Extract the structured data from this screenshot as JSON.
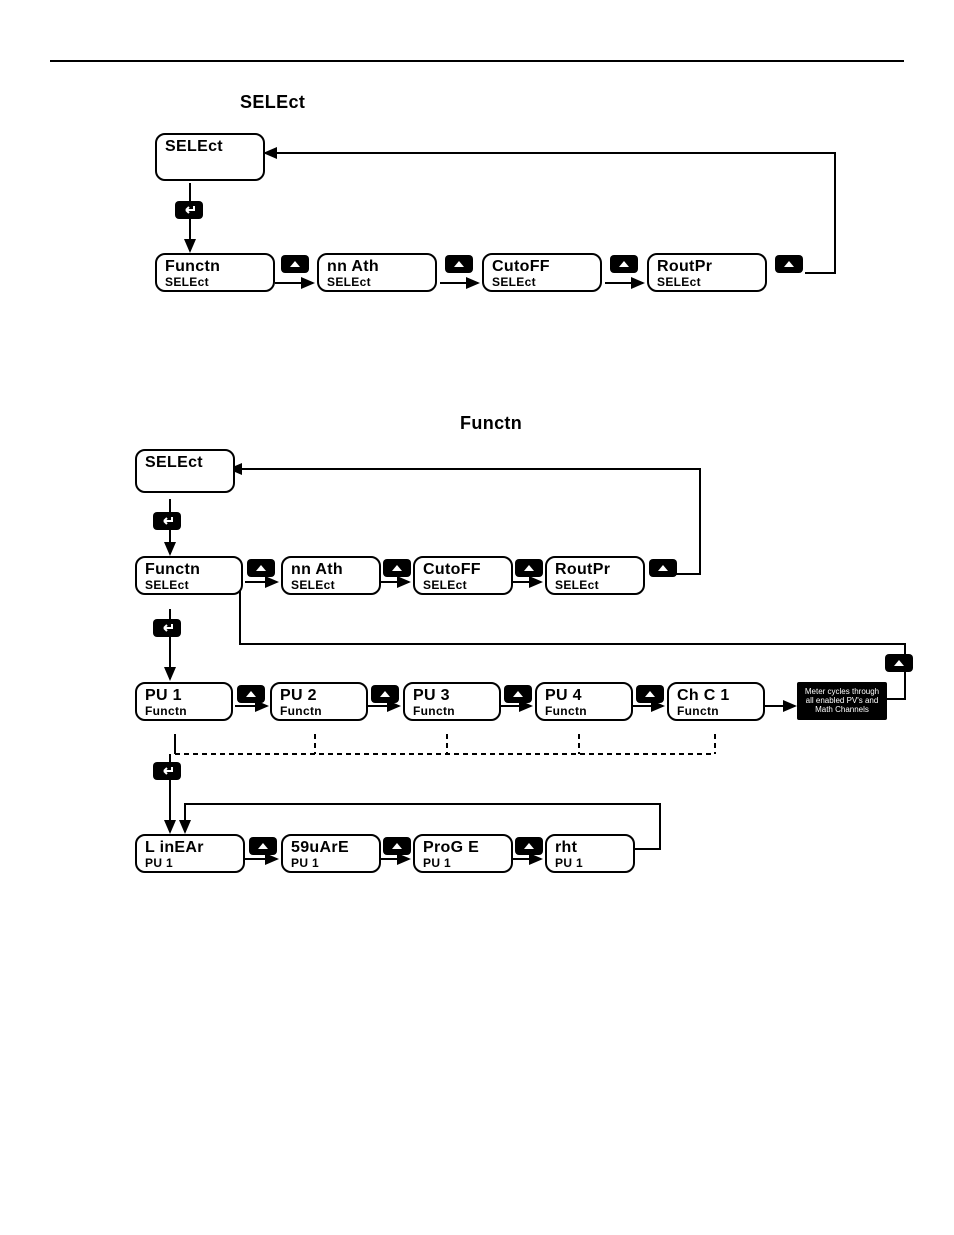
{
  "header_word": "SELEct",
  "section2_word": "Functn",
  "diagram1": {
    "top": {
      "line1": "SELEct"
    },
    "row": [
      {
        "line1": "Functn",
        "line2": "SELEct"
      },
      {
        "line1": "nn Ath",
        "line2": "SELEct"
      },
      {
        "line1": "CutoFF",
        "line2": "SELEct"
      },
      {
        "line1": "RoutPr",
        "line2": "SELEct"
      }
    ]
  },
  "diagram2": {
    "top": {
      "line1": "SELEct"
    },
    "row1": [
      {
        "line1": "Functn",
        "line2": "SELEct"
      },
      {
        "line1": "nn Ath",
        "line2": "SELEct"
      },
      {
        "line1": "CutoFF",
        "line2": "SELEct"
      },
      {
        "line1": "RoutPr",
        "line2": "SELEct"
      }
    ],
    "row2": [
      {
        "line1": "PU  1",
        "line2": "Functn"
      },
      {
        "line1": "PU  2",
        "line2": "Functn"
      },
      {
        "line1": "PU  3",
        "line2": "Functn"
      },
      {
        "line1": "PU  4",
        "line2": "Functn"
      },
      {
        "line1": "Ch C 1",
        "line2": "Functn"
      }
    ],
    "note": "Meter cycles through all enabled PV's and Math Channels",
    "row3": [
      {
        "line1": "L inEAr",
        "line2": "PU  1"
      },
      {
        "line1": "59uArE",
        "line2": "PU  1"
      },
      {
        "line1": "ProG E",
        "line2": "PU  1"
      },
      {
        "line1": "rht",
        "line2": "PU  1"
      }
    ]
  }
}
